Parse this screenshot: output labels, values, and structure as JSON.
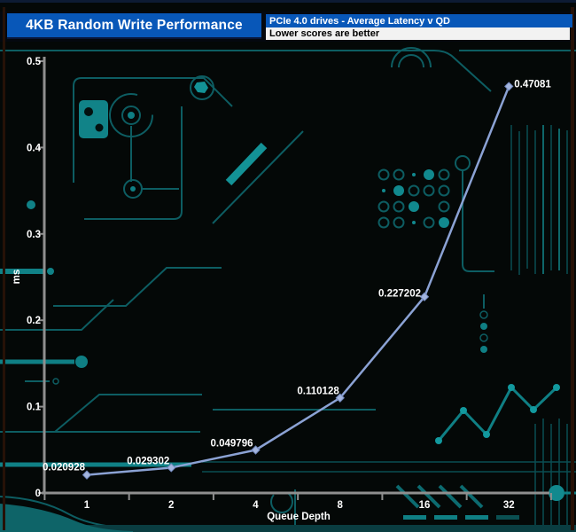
{
  "header": {
    "title": "4KB Random Write Performance",
    "subtitle": "PCIe 4.0 drives -  Average Latency v QD",
    "note": "Lower scores are better"
  },
  "colors": {
    "header_blue": "#0857b8",
    "note_bg": "#f2f2f2",
    "line": "#8ba2d4",
    "marker_fill": "#a3b5de",
    "marker_stroke": "#7288bd",
    "axis_gray": "#8f8f8f",
    "label_text": "#ffffff",
    "trace_teal": "#0d5d62",
    "trace_bright": "#139296"
  },
  "chart_data": {
    "type": "line",
    "title": "4KB Random Write Performance",
    "subtitle": "PCIe 4.0 drives - Average Latency v QD",
    "note": "Lower scores are better",
    "xlabel": "Queue Depth",
    "ylabel": "ms",
    "categories": [
      "1",
      "2",
      "4",
      "8",
      "16",
      "32"
    ],
    "series": [
      {
        "name": "PCIe 4.0 drives",
        "values": [
          0.020928,
          0.029302,
          0.049796,
          0.110128,
          0.227202,
          0.47081
        ]
      }
    ],
    "data_labels": [
      "0.020928",
      "0.029302",
      "0.049796",
      "0.110128",
      "0.227202",
      "0.47081"
    ],
    "y_ticks": [
      "0",
      "0.1",
      "0.2",
      "0.3",
      "0.4",
      "0.5"
    ],
    "ylim": [
      0,
      0.5
    ],
    "grid": false,
    "legend": "none"
  }
}
